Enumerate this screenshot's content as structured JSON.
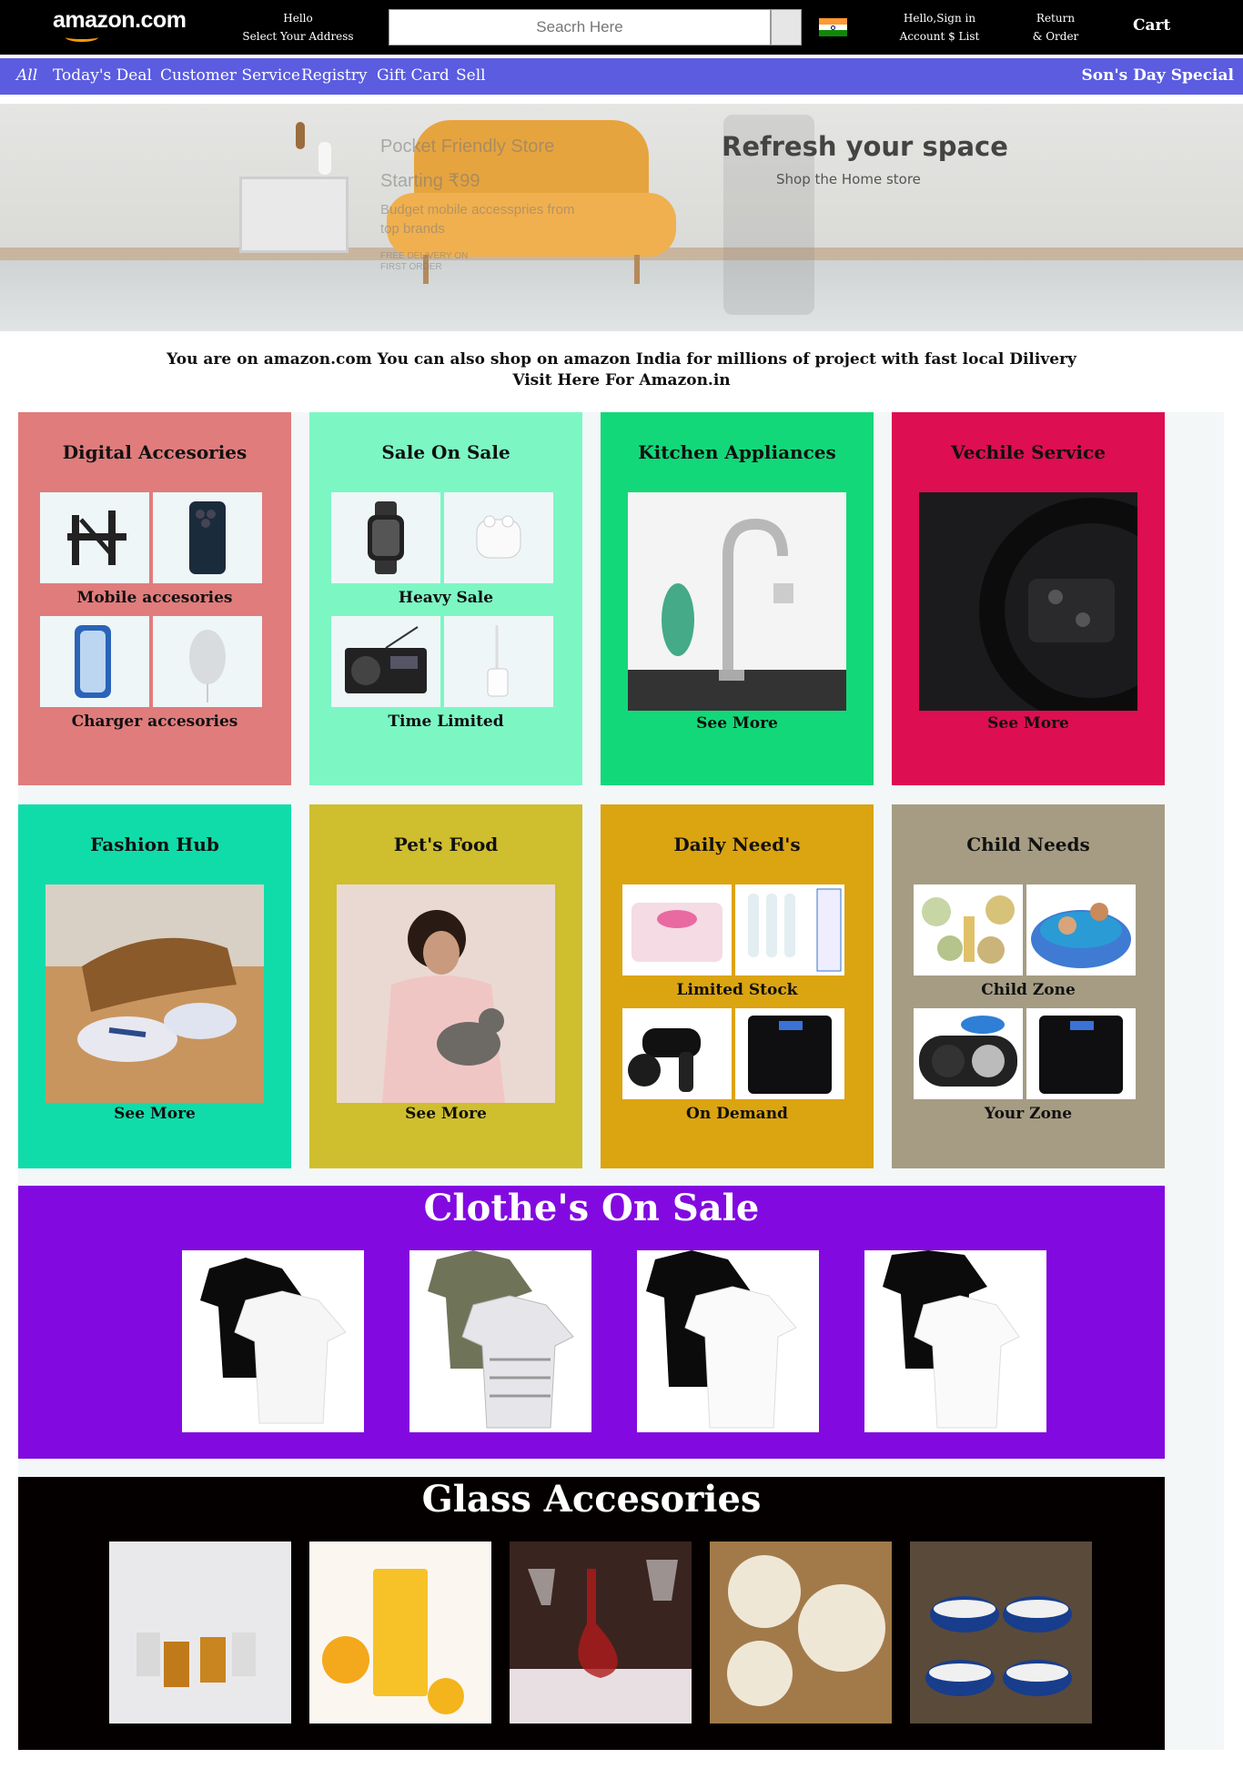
{
  "header": {
    "logo": "amazon.com",
    "address_line1": "Hello",
    "address_line2": "Select Your Address",
    "search_placeholder": "Seacrh Here",
    "account_line1": "Hello,Sign in",
    "account_line2": "Account $ List",
    "returns_line1": "Return",
    "returns_line2": "& Order",
    "cart": "Cart"
  },
  "subnav": {
    "items": [
      "All",
      "Today's Deal",
      "Customer Service",
      "Registry",
      "Gift Card",
      "Sell"
    ],
    "special": "Son's Day Special"
  },
  "banner": {
    "headline": "Refresh your space",
    "subline": "Shop the Home store",
    "faded_1": "Pocket Friendly Store",
    "faded_2": "Starting ₹99",
    "faded_3": "Budget mobile accesspries from top brands",
    "faded_4": "FREE DELIVERY ON FIRST ORDER"
  },
  "notice": {
    "line1": "You are on amazon.com You can also shop on amazon India for millions of project with fast local Dilivery",
    "line2": "Visit Here For Amazon.in"
  },
  "cards": [
    {
      "title": "Digital Accesories",
      "color": "#e07c7c",
      "caption1": "Mobile accesories",
      "caption2": "Charger accesories",
      "images": [
        "tv-wall-mount",
        "smartphone",
        "phone-case",
        "wireless-charger"
      ]
    },
    {
      "title": "Sale On Sale",
      "color": "#7cf7c4",
      "caption1": "Heavy Sale",
      "caption2": "Time Limited",
      "images": [
        "smartwatch",
        "earbuds",
        "radio",
        "usb-adapter"
      ]
    },
    {
      "title": "Kitchen Appliances",
      "color": "#13d879",
      "caption": "See More",
      "image": "kitchen-faucet"
    },
    {
      "title": "Vechile Service",
      "color": "#dd0e51",
      "caption": "See More",
      "image": "steering-wheel"
    },
    {
      "title": "Fashion Hub",
      "color": "#10dcaa",
      "caption": "See More",
      "image": "sneakers"
    },
    {
      "title": "Pet's Food",
      "color": "#cfbe2e",
      "caption": "See More",
      "image": "woman-with-cat"
    },
    {
      "title": "Daily Need's",
      "color": "#dba411",
      "caption1": "Limited Stock",
      "caption2": "On Demand",
      "images": [
        "wipes",
        "toothbrush-heads",
        "hair-dryer",
        "scale"
      ]
    },
    {
      "title": "Child Needs",
      "color": "#a59c83",
      "caption1": "Child Zone",
      "caption2": "Your Zone",
      "images": [
        "party-decor",
        "kids-pool",
        "pet-bowls",
        "scale"
      ]
    }
  ],
  "clothes": {
    "title": "Clothe's On Sale",
    "color": "#820ae0",
    "items": [
      "tshirt-black-white",
      "tshirt-camo-stripe",
      "tshirt-black-white-v",
      "tshirt-black-white-2"
    ]
  },
  "glass": {
    "title": "Glass Accesories",
    "color": "#050000",
    "items": [
      "shot-glasses",
      "juice-glass",
      "wine-decanter",
      "ceramic-plates",
      "blue-bowls"
    ]
  }
}
